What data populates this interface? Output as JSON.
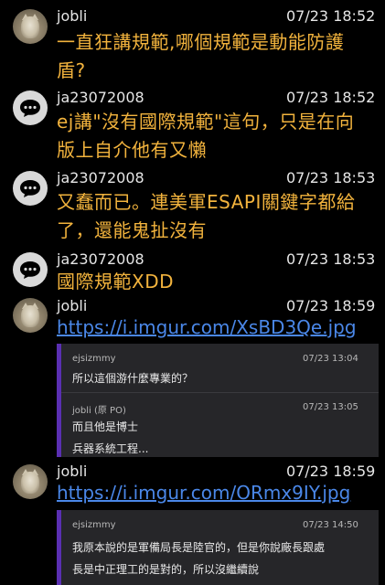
{
  "comments": [
    {
      "user": "jobli",
      "time": "07/23 18:52",
      "avatar": "cat-photo",
      "lines": [
        "一直狂講規範,哪個規範是動能防護",
        "盾?"
      ]
    },
    {
      "user": "ja23072008",
      "time": "07/23 18:52",
      "avatar": "chat-bubble-icon",
      "lines": [
        "ej講\"沒有國際規範\"這句，只是在向",
        "版上自介他有又懶"
      ]
    },
    {
      "user": "ja23072008",
      "time": "07/23 18:53",
      "avatar": "chat-bubble-icon",
      "lines": [
        "又蠢而已。連美軍ESAPI關鍵字都給",
        "了，還能鬼扯沒有"
      ]
    },
    {
      "user": "ja23072008",
      "time": "07/23 18:53",
      "avatar": "chat-bubble-icon",
      "lines": [
        "國際規範XDD"
      ]
    },
    {
      "user": "jobli",
      "time": "07/23 18:59",
      "avatar": "cat-photo",
      "link": "https://i.imgur.com/XsBD3Qe.jpg",
      "quotes": [
        {
          "user": "ejsizmmy",
          "time": "07/23 13:04",
          "lines": [
            "所以這個游什麼專業的？"
          ]
        },
        {
          "user": "jobli (原 PO)",
          "time": "07/23 13:05",
          "lines": [
            "而且他是博士",
            "兵器系統工程..."
          ]
        }
      ]
    },
    {
      "user": "jobli",
      "time": "07/23 18:59",
      "avatar": "cat-photo",
      "link": "https://i.imgur.com/ORmx9IY.jpg",
      "quotes": [
        {
          "user": "ejsizmmy",
          "time": "07/23 14:50",
          "lines": [
            "我原本說的是軍備局長是陸官的，但是你說廠長跟處",
            "長是中正理工的是對的，所以沒繼續說"
          ]
        }
      ]
    }
  ],
  "colors": {
    "background": "#000000",
    "push_text": "#f2b33d",
    "link": "#4a87e8",
    "quote_bar": "#5a2fb2",
    "quote_bg": "#262629"
  }
}
